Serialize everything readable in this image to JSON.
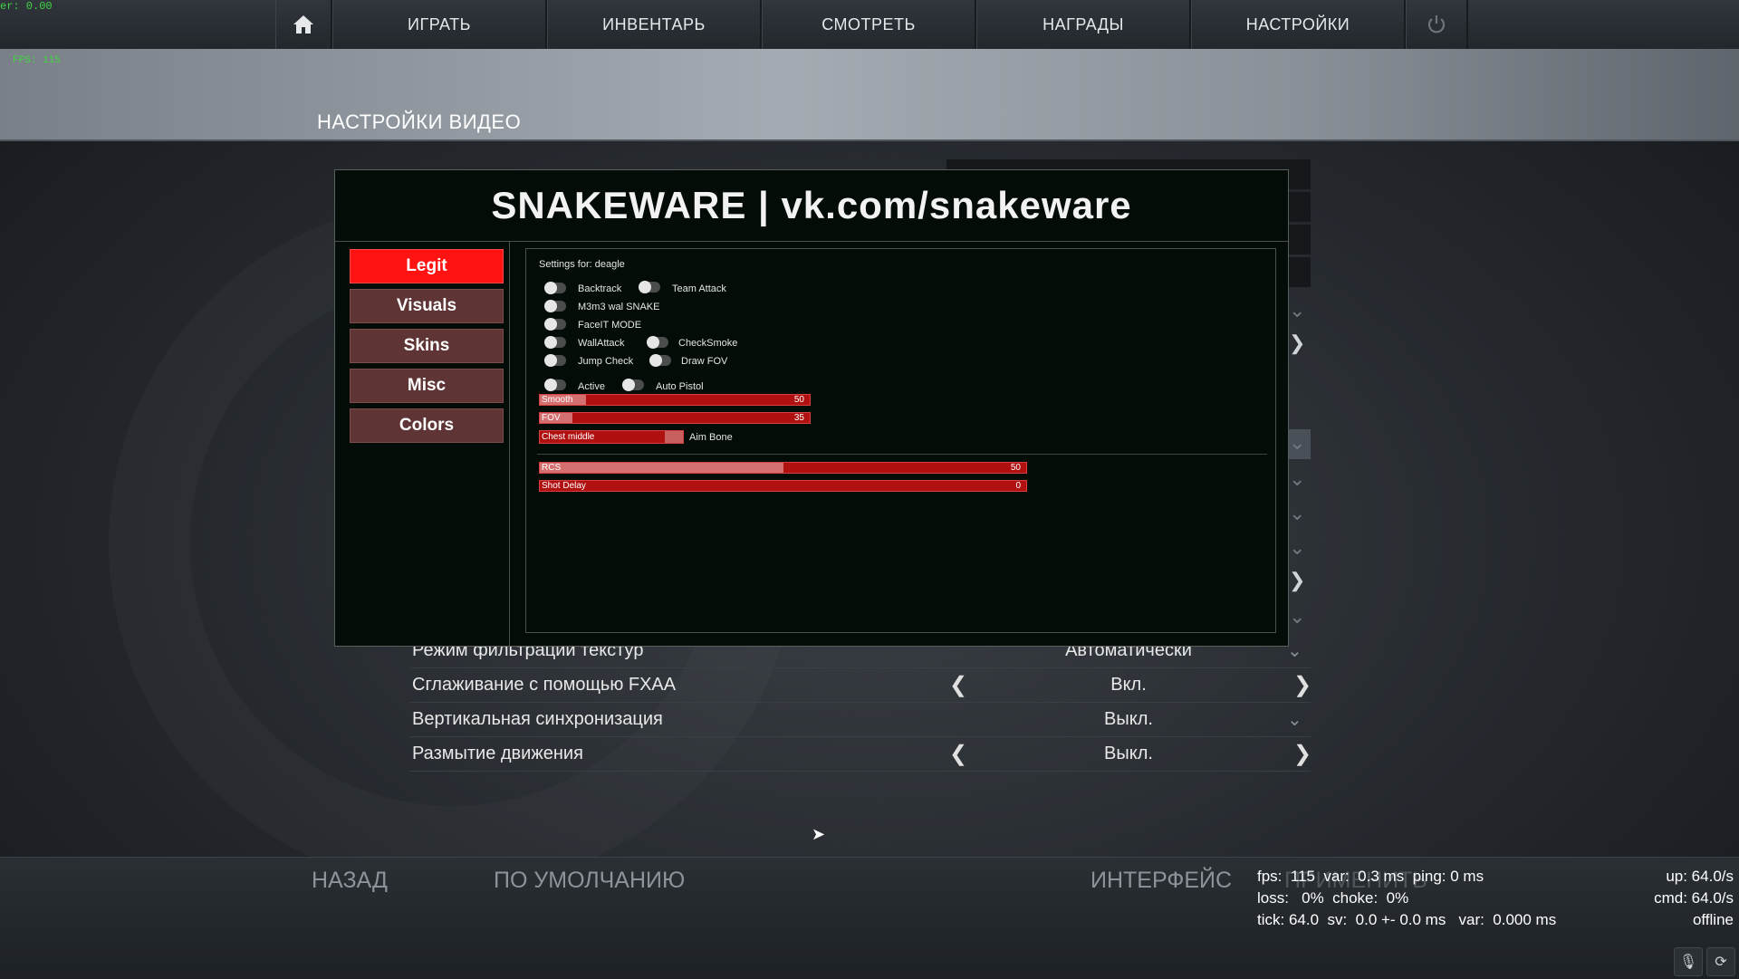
{
  "debug": {
    "timer": "er: 0.00",
    "fps": "FPS: 115"
  },
  "nav": {
    "items": [
      "ИГРАТЬ",
      "ИНВЕНТАРЬ",
      "СМОТРЕТЬ",
      "НАГРАДЫ",
      "НАСТРОЙКИ"
    ],
    "home_icon": "home-icon",
    "power_icon": "power-icon"
  },
  "page_title": "НАСТРОЙКИ ВИДЕО",
  "video_settings": [
    {
      "label": "Режим фильтрации текстур",
      "value": "Автоматически",
      "control": "dropdown"
    },
    {
      "label": "Сглаживание с помощью FXAA",
      "value": "Вкл.",
      "control": "arrows"
    },
    {
      "label": "Вертикальная синхронизация",
      "value": "Выкл.",
      "control": "dropdown"
    },
    {
      "label": "Размытие движения",
      "value": "Выкл.",
      "control": "arrows"
    }
  ],
  "bottom": {
    "back": "НАЗАД",
    "default": "ПО УМОЛЧАНИЮ",
    "interface": "ИНТЕРФЕЙС",
    "apply": "ПРИМЕНИТЬ"
  },
  "netgraph": {
    "line1": "fps:  115  var:  0.3 ms  ping: 0 ms",
    "line2": "loss:   0%  choke:  0%",
    "line3": "tick: 64.0  sv:  0.0 +- 0.0 ms   var:  0.000 ms",
    "up": "up: 64.0/s",
    "cmd": "cmd: 64.0/s",
    "status": "offline"
  },
  "cheat": {
    "title": "SNAKEWARE | vk.com/snakeware",
    "tabs": [
      {
        "label": "Legit",
        "active": true
      },
      {
        "label": "Visuals",
        "active": false
      },
      {
        "label": "Skins",
        "active": false
      },
      {
        "label": "Misc",
        "active": false
      },
      {
        "label": "Colors",
        "active": false
      }
    ],
    "settings_for": "Settings for:  deagle",
    "toggles": {
      "backtrack": "Backtrack",
      "team_attack": "Team Attack",
      "m3m3": "M3m3 wal SNAKE",
      "faceit": "FaceIT MODE",
      "wallattack": "WallAttack",
      "checksmoke": "CheckSmoke",
      "jumpcheck": "Jump Check",
      "drawfov": "Draw FOV",
      "active": "Active",
      "autopistol": "Auto Pistol"
    },
    "sliders": {
      "smooth": {
        "name": "Smooth",
        "value": "50",
        "fill": 0.17
      },
      "fov": {
        "name": "FOV",
        "value": "35",
        "fill": 0.12
      },
      "rcs": {
        "name": "RCS",
        "value": "50",
        "fill": 0.5
      },
      "shot_delay": {
        "name": "Shot Delay",
        "value": "0",
        "fill": 0.0
      }
    },
    "aim_bone": {
      "selected": "Chest middle",
      "label": "Aim Bone"
    }
  }
}
